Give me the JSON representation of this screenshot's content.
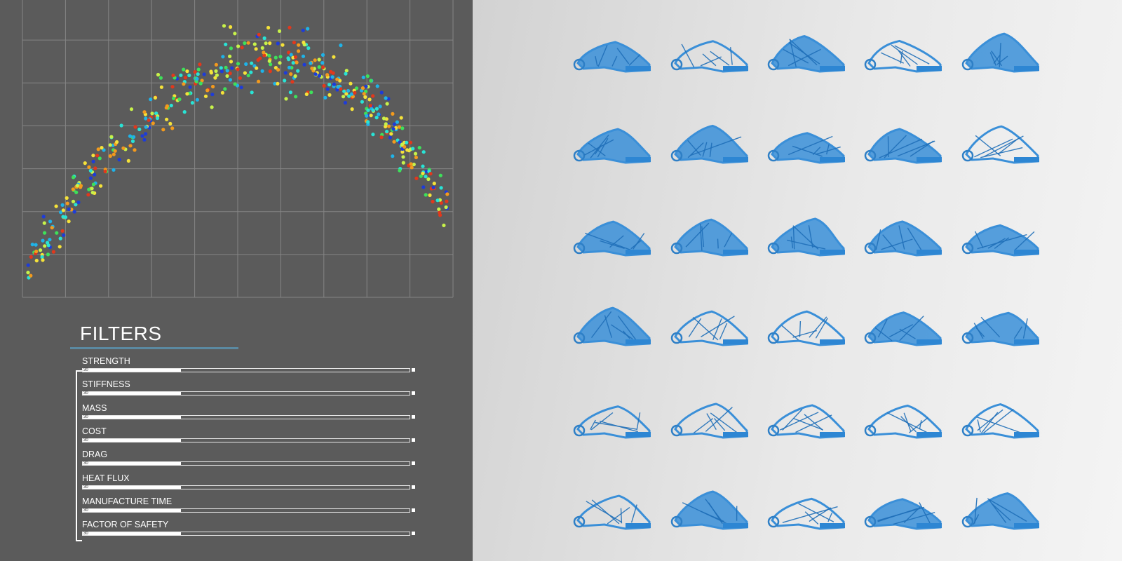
{
  "scatter": {
    "type": "scatter",
    "xlim": [
      0,
      10
    ],
    "ylim": [
      0,
      7
    ],
    "grid": true,
    "colors": [
      "#1e3cd8",
      "#1fb3e8",
      "#29e3d5",
      "#3ee05a",
      "#c7f24a",
      "#f5e23a",
      "#f39a1d",
      "#e2381c"
    ]
  },
  "filters": {
    "title": "FILTERS",
    "accent_color": "#5b8aa2",
    "items": [
      {
        "label": "STRENGTH",
        "value": "30",
        "fill": 0.3
      },
      {
        "label": "STIFFNESS",
        "value": "30",
        "fill": 0.3
      },
      {
        "label": "MASS",
        "value": "30",
        "fill": 0.3
      },
      {
        "label": "COST",
        "value": "30",
        "fill": 0.3
      },
      {
        "label": "DRAG",
        "value": "30",
        "fill": 0.3
      },
      {
        "label": "HEAT FLUX",
        "value": "30",
        "fill": 0.3
      },
      {
        "label": "MANUFACTURE TIME",
        "value": "30",
        "fill": 0.3
      },
      {
        "label": "FACTOR OF SAFETY",
        "value": "30",
        "fill": 0.3
      }
    ]
  },
  "designs": {
    "rows": 6,
    "cols": 5,
    "color": "#3a8fd8",
    "icon": "chassis-design-icon"
  }
}
